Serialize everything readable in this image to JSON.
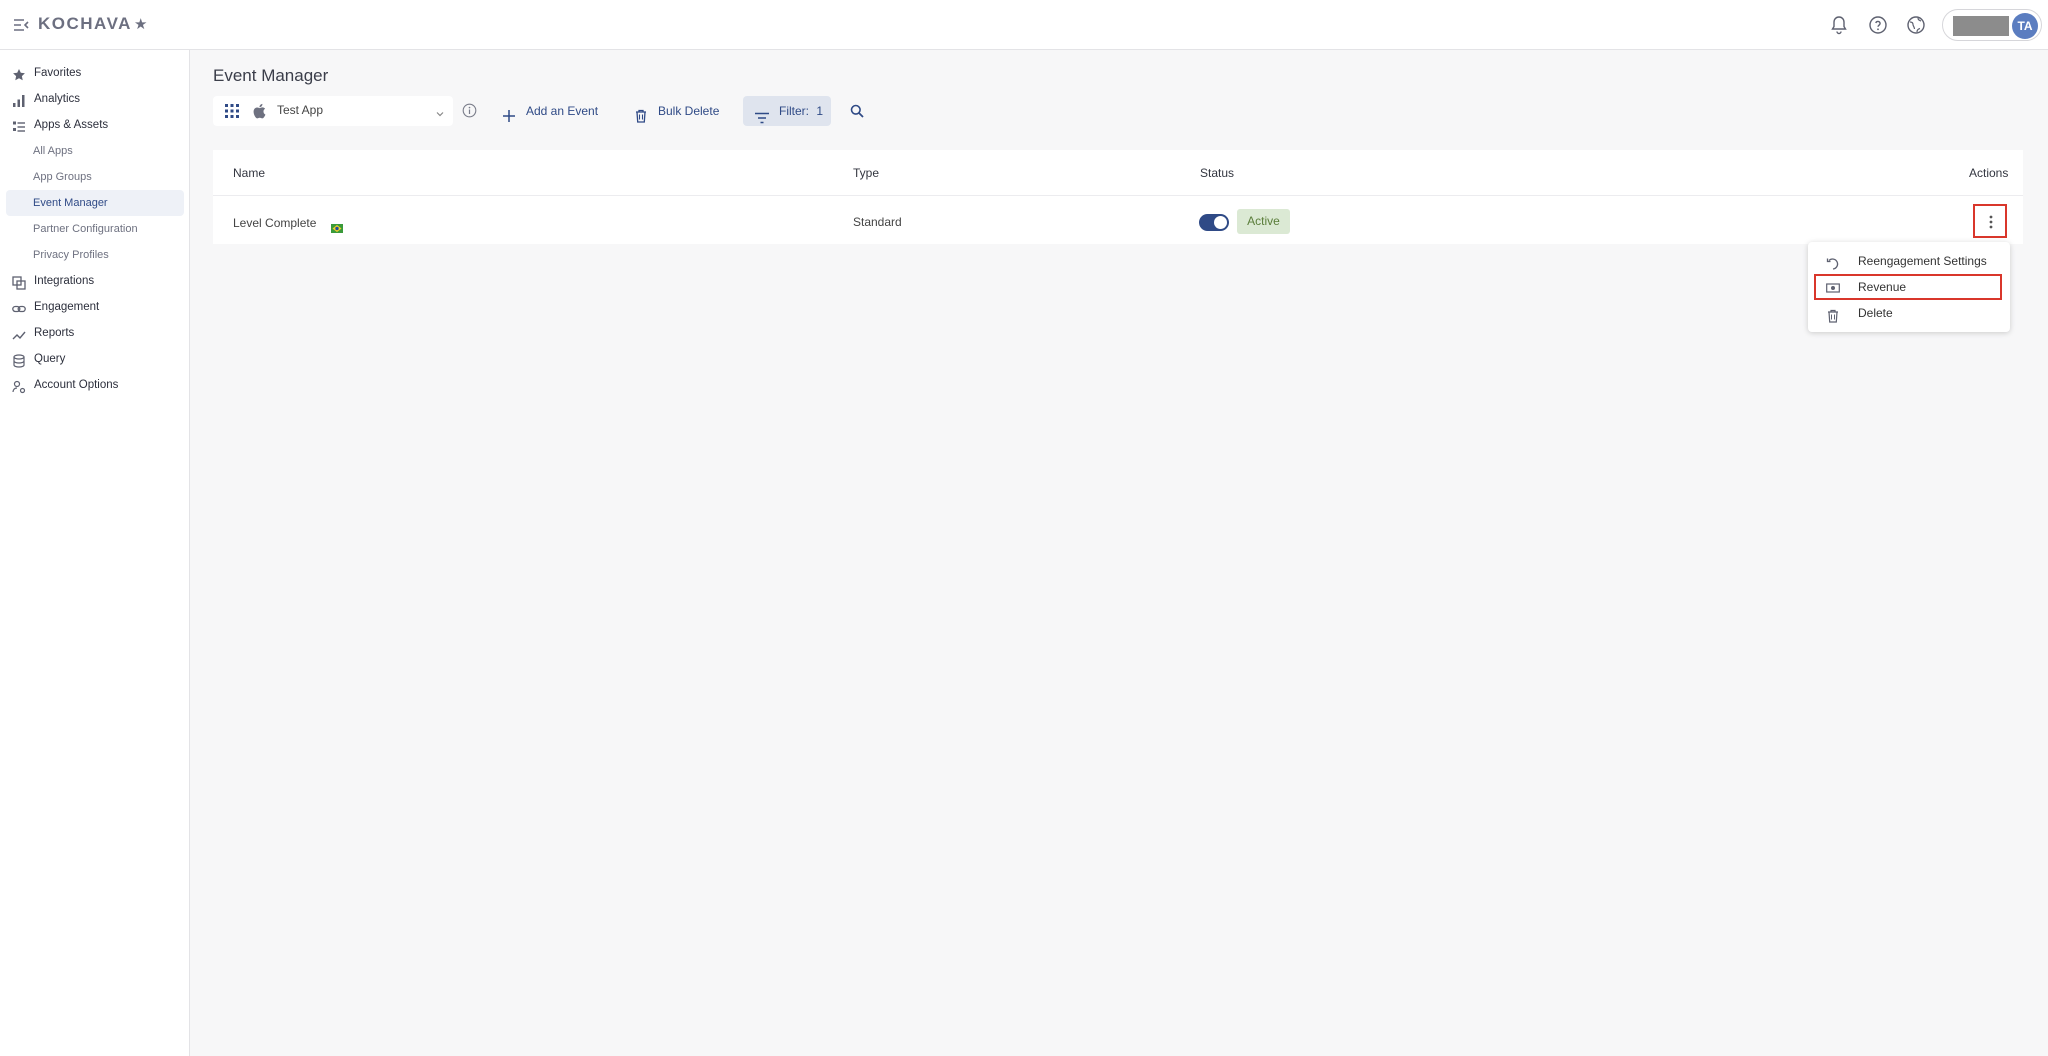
{
  "app": {
    "logo_text": "KOCHAVA",
    "logo_star": "★",
    "avatar_initials": "TA"
  },
  "topbar_icons": [
    "bell-icon",
    "help-icon",
    "globe-icon"
  ],
  "sidebar": {
    "items": [
      {
        "label": "Favorites",
        "icon": "star-icon"
      },
      {
        "label": "Analytics",
        "icon": "bar-chart-icon"
      },
      {
        "label": "Apps & Assets",
        "icon": "apps-list-icon"
      }
    ],
    "sub_items": [
      {
        "label": "All Apps"
      },
      {
        "label": "App Groups"
      },
      {
        "label": "Event Manager",
        "active": true
      },
      {
        "label": "Partner Configuration"
      },
      {
        "label": "Privacy Profiles"
      }
    ],
    "items_after": [
      {
        "label": "Integrations",
        "icon": "integrations-icon"
      },
      {
        "label": "Engagement",
        "icon": "link-icon"
      },
      {
        "label": "Reports",
        "icon": "trend-icon"
      },
      {
        "label": "Query",
        "icon": "database-icon"
      },
      {
        "label": "Account Options",
        "icon": "account-options-icon"
      }
    ]
  },
  "page": {
    "title": "Event Manager"
  },
  "toolbar": {
    "app_select_value": "Test App",
    "add_event_label": "Add an Event",
    "bulk_delete_label": "Bulk Delete",
    "filter_label": "Filter:",
    "filter_count": "1"
  },
  "table": {
    "headers": {
      "name": "Name",
      "type": "Type",
      "status": "Status",
      "actions": "Actions"
    },
    "rows": [
      {
        "name": "Level Complete",
        "type": "Standard",
        "status": "Active",
        "enabled": true
      }
    ]
  },
  "menu": {
    "items": [
      {
        "label": "Reengagement Settings",
        "icon": "reengagement-icon"
      },
      {
        "label": "Revenue",
        "icon": "money-icon"
      },
      {
        "label": "Delete",
        "icon": "trash-icon"
      }
    ]
  },
  "colors": {
    "accent": "#2f4a86",
    "highlight": "#d9362b",
    "active_badge_bg": "#dbe9d4",
    "active_badge_text": "#5a7d3a"
  }
}
